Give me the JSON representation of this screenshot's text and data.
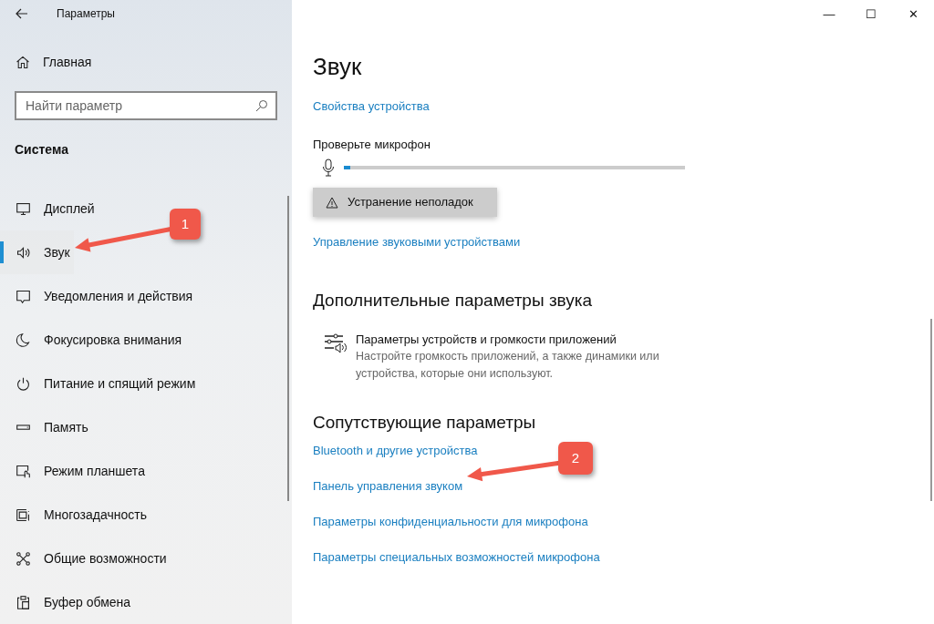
{
  "window": {
    "title": "Параметры",
    "controls": [
      "—",
      "☐",
      "✕"
    ]
  },
  "sidebar": {
    "home": "Главная",
    "search": {
      "placeholder": "Найти параметр"
    },
    "section": "Система",
    "items": [
      {
        "label": "Дисплей",
        "selected": false
      },
      {
        "label": "Звук",
        "selected": true
      },
      {
        "label": "Уведомления и действия",
        "selected": false
      },
      {
        "label": "Фокусировка внимания",
        "selected": false
      },
      {
        "label": "Питание и спящий режим",
        "selected": false
      },
      {
        "label": "Память",
        "selected": false
      },
      {
        "label": "Режим планшета",
        "selected": false
      },
      {
        "label": "Многозадачность",
        "selected": false
      },
      {
        "label": "Общие возможности",
        "selected": false
      },
      {
        "label": "Буфер обмена",
        "selected": false
      }
    ]
  },
  "main": {
    "title": "Звук",
    "device_link": "Свойства устройства",
    "mic_test": {
      "label": "Проверьте микрофон",
      "level": 0.02
    },
    "troubleshoot": "Устранение неполадок",
    "manage_link": "Управление звуковыми устройствами",
    "advanced": {
      "heading": "Дополнительные параметры звука",
      "title": "Параметры устройств и громкости приложений",
      "description": "Настройте громкость приложений, а также динамики или устройства, которые они используют."
    },
    "related": {
      "heading": "Сопутствующие параметры",
      "links": [
        "Bluetooth и другие устройства",
        "Панель управления звуком",
        "Параметры конфиденциальности для микрофона",
        "Параметры специальных возможностей микрофона"
      ]
    }
  },
  "annotations": [
    "1",
    "2"
  ]
}
